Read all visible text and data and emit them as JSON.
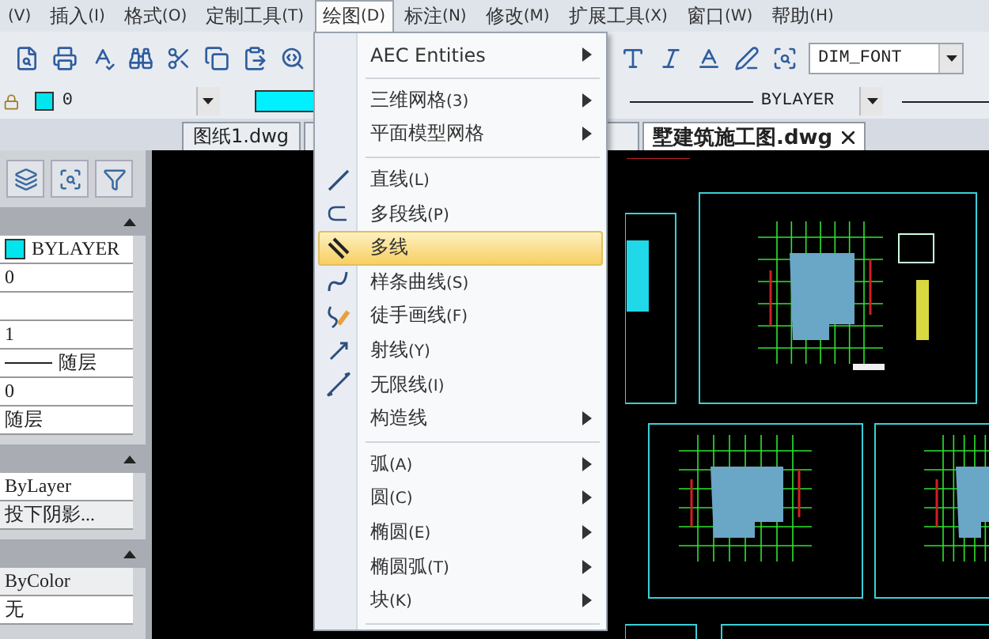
{
  "menubar": [
    {
      "key": "(V)",
      "selected": false
    },
    {
      "label": "插入",
      "key": "(I)",
      "selected": false
    },
    {
      "label": "格式",
      "key": "(O)",
      "selected": false
    },
    {
      "label": "定制工具",
      "key": "(T)",
      "selected": false
    },
    {
      "label": "绘图",
      "key": "(D)",
      "selected": true
    },
    {
      "label": "标注",
      "key": "(N)",
      "selected": false
    },
    {
      "label": "修改",
      "key": "(M)",
      "selected": false
    },
    {
      "label": "扩展工具",
      "key": "(X)",
      "selected": false
    },
    {
      "label": "窗口",
      "key": "(W)",
      "selected": false
    },
    {
      "label": "帮助",
      "key": "(H)",
      "selected": false
    }
  ],
  "toolbar": {
    "text_style": "DIM_FONT",
    "layer": "0",
    "linetype": "BYLAYER"
  },
  "tabs": [
    {
      "label": "图纸1.dwg",
      "selected": false
    },
    {
      "selected": false
    },
    {
      "label": "墅建筑施工图.dwg",
      "selected": true
    }
  ],
  "properties": {
    "sections": [
      {
        "rows": [
          {
            "kind": "swatch",
            "value": "BYLAYER"
          },
          {
            "kind": "text",
            "value": "0"
          },
          {
            "kind": "blank"
          },
          {
            "kind": "text",
            "value": "1"
          },
          {
            "kind": "line",
            "value": "随层"
          },
          {
            "kind": "text",
            "value": "0"
          },
          {
            "kind": "text",
            "value": "随层"
          }
        ]
      },
      {
        "rows": [
          {
            "kind": "text",
            "value": "ByLayer"
          },
          {
            "kind": "shaded",
            "value": "投下阴影..."
          }
        ]
      },
      {
        "rows": [
          {
            "kind": "shaded",
            "value": "ByColor"
          },
          {
            "kind": "text",
            "value": "无"
          }
        ]
      }
    ]
  },
  "draw_menu": {
    "items": [
      {
        "kind": "submenu",
        "label": "AEC Entities",
        "selected": false
      },
      {
        "kind": "separator"
      },
      {
        "kind": "submenu",
        "label": "三维网格",
        "key": "(3)",
        "selected": false
      },
      {
        "kind": "submenu",
        "label": "平面模型网格",
        "selected": false
      },
      {
        "kind": "separator"
      },
      {
        "kind": "command",
        "label": "直线",
        "key": "(L)",
        "selected": false
      },
      {
        "kind": "command",
        "label": "多段线",
        "key": "(P)",
        "selected": false
      },
      {
        "kind": "command",
        "label": "多线",
        "selected": true
      },
      {
        "kind": "command",
        "label": "样条曲线",
        "key": "(S)",
        "selected": false
      },
      {
        "kind": "command",
        "label": "徒手画线",
        "key": "(F)",
        "selected": false
      },
      {
        "kind": "command",
        "label": "射线",
        "key": "(Y)",
        "selected": false
      },
      {
        "kind": "command",
        "label": "无限线",
        "key": "(I)",
        "selected": false
      },
      {
        "kind": "submenu",
        "label": "构造线",
        "selected": false
      },
      {
        "kind": "separator"
      },
      {
        "kind": "submenu",
        "label": "弧",
        "key": "(A)",
        "selected": false
      },
      {
        "kind": "submenu",
        "label": "圆",
        "key": "(C)",
        "selected": false
      },
      {
        "kind": "submenu",
        "label": "椭圆",
        "key": "(E)",
        "selected": false
      },
      {
        "kind": "submenu",
        "label": "椭圆弧",
        "key": "(T)",
        "selected": false
      },
      {
        "kind": "submenu",
        "label": "块",
        "key": "(K)",
        "selected": false
      },
      {
        "kind": "separator"
      }
    ]
  }
}
